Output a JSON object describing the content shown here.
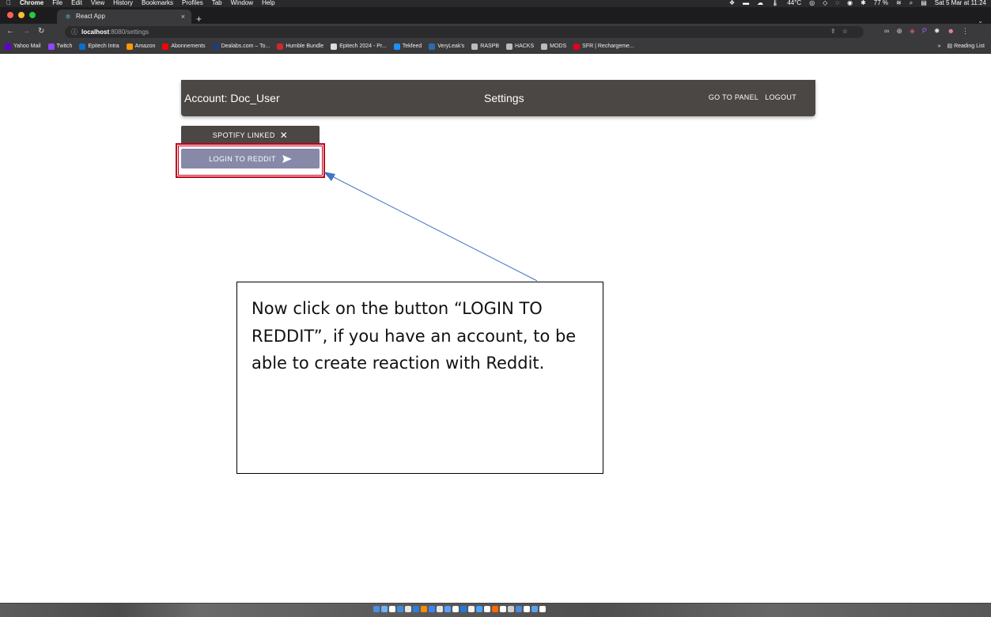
{
  "menubar": {
    "apple": "",
    "items": [
      "Chrome",
      "File",
      "Edit",
      "View",
      "History",
      "Bookmarks",
      "Profiles",
      "Tab",
      "Window",
      "Help"
    ],
    "temperature": "44°C",
    "battery": "77 %",
    "datetime": "Sat 5 Mar at 11:24"
  },
  "tab": {
    "title": "React App",
    "close": "×",
    "new_tab": "+"
  },
  "address": {
    "host": "localhost",
    "path": ":8080/settings"
  },
  "bookmarks": [
    {
      "label": "Yahoo Mail",
      "color": "#6001d2"
    },
    {
      "label": "Twitch",
      "color": "#9146ff"
    },
    {
      "label": "Epitech Intra",
      "color": "#0b6fcb"
    },
    {
      "label": "Amazon",
      "color": "#ff9900"
    },
    {
      "label": "Abonnements",
      "color": "#ff0000"
    },
    {
      "label": "Dealabs.com – To...",
      "color": "#1f3d7a"
    },
    {
      "label": "Humble Bundle",
      "color": "#cc2929"
    },
    {
      "label": "Epitech 2024 - Pr...",
      "color": "#dddddd"
    },
    {
      "label": "Tekfeed",
      "color": "#1e90ff"
    },
    {
      "label": "VeryLeak's",
      "color": "#2b6cb0"
    },
    {
      "label": "RASPB",
      "color": "#bbbbbb"
    },
    {
      "label": "HACKS",
      "color": "#bbbbbb"
    },
    {
      "label": "MODS",
      "color": "#bbbbbb"
    },
    {
      "label": "SFR | Rechargeme...",
      "color": "#e2001a"
    }
  ],
  "bookmarks_right": {
    "more": "»",
    "reading_list": "Reading List"
  },
  "appbar": {
    "account": "Account: Doc_User",
    "title": "Settings",
    "go_to_panel": "GO TO PANEL",
    "logout": "LOGOUT"
  },
  "buttons": {
    "spotify": "SPOTIFY LINKED",
    "spotify_icon": "close-icon",
    "reddit": "LOGIN TO REDDIT",
    "reddit_icon": "send-arrow-icon"
  },
  "annotation": {
    "text": "Now click on the button “LOGIN TO REDDIT”, if you have an account, to be able to create reaction with Reddit.",
    "highlight_color": "#c0001a",
    "arrow_color": "#4472c4"
  }
}
